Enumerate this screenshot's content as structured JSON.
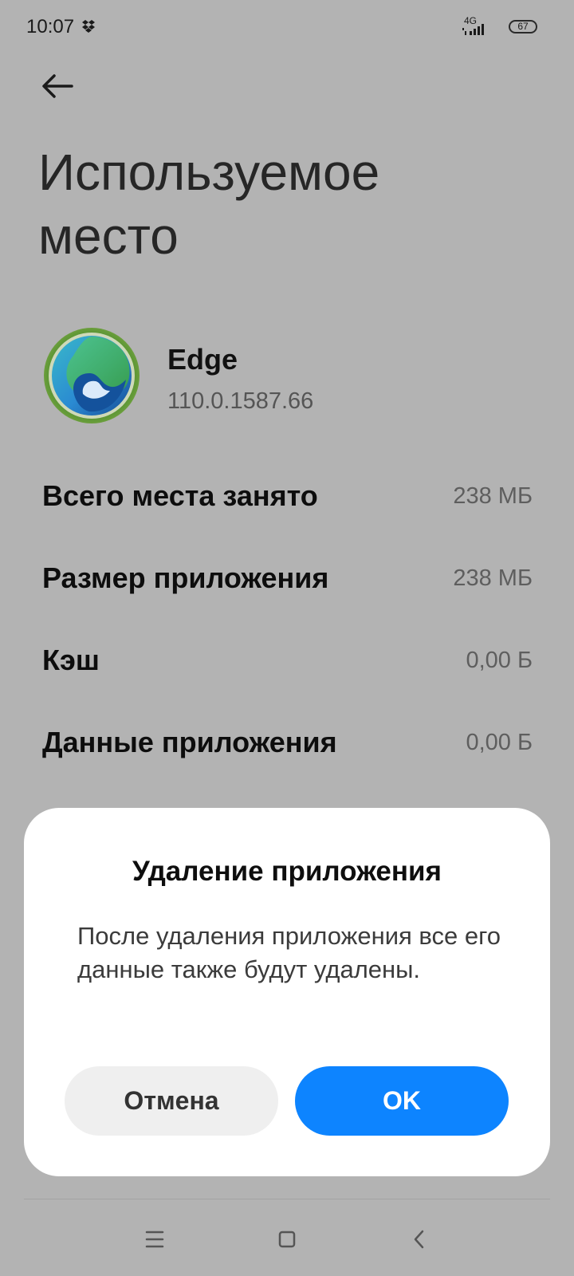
{
  "status_bar": {
    "time": "10:07",
    "network": "4G",
    "battery": "67",
    "icons": [
      "dropbox-icon",
      "signal-icon",
      "battery-icon"
    ]
  },
  "header": {
    "back_icon": "arrow-left-icon",
    "title": "Используемое место"
  },
  "app": {
    "name": "Edge",
    "version": "110.0.1587.66",
    "icon": "edge-app-icon"
  },
  "storage": {
    "rows": [
      {
        "label": "Всего места занято",
        "value": "238 МБ"
      },
      {
        "label": "Размер приложения",
        "value": "238 МБ"
      },
      {
        "label": "Кэш",
        "value": "0,00 Б"
      },
      {
        "label": "Данные приложения",
        "value": "0,00 Б"
      }
    ]
  },
  "dialog": {
    "title": "Удаление приложения",
    "message": "После удаления приложения все его данные также будут удалены.",
    "cancel_label": "Отмена",
    "ok_label": "OK"
  },
  "nav_bar": {
    "icons": [
      "menu-icon",
      "home-icon",
      "back-icon"
    ]
  },
  "colors": {
    "accent": "#0d84ff",
    "scrim_background": "#b3b3b3",
    "dialog_background": "#ffffff"
  }
}
